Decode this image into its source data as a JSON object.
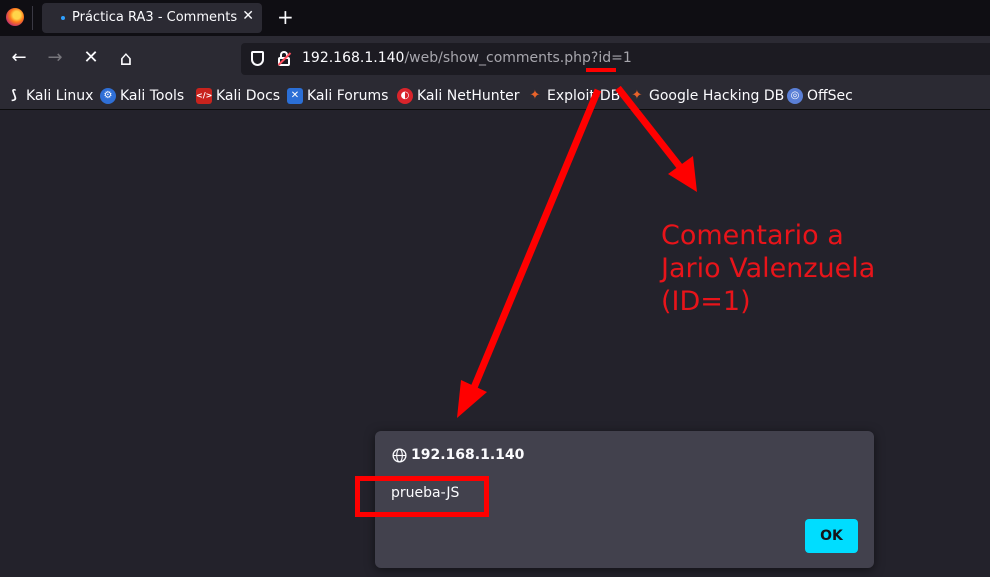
{
  "browser": {
    "tab_title": "Práctica RA3 - Comments",
    "tab_close_glyph": "✕",
    "new_tab_glyph": "+",
    "url_host": "192.168.1.140",
    "url_path": "/web/show_comments.php?id=1"
  },
  "nav": {
    "back_glyph": "←",
    "forward_glyph": "→",
    "stop_glyph": "✕",
    "home_glyph": "⌂"
  },
  "bookmarks": [
    {
      "label": "Kali Linux",
      "icon": "kali-dragon-icon",
      "color": "#111111"
    },
    {
      "label": "Kali Tools",
      "icon": "kali-tools-icon",
      "color": "#2f6fd6"
    },
    {
      "label": "Kali Docs",
      "icon": "kali-docs-icon",
      "color": "#c8231d"
    },
    {
      "label": "Kali Forums",
      "icon": "kali-forums-icon",
      "color": "#2b6fd6"
    },
    {
      "label": "Kali NetHunter",
      "icon": "nethunter-icon",
      "color": "#d9242b"
    },
    {
      "label": "Exploit-DB",
      "icon": "exploit-db-icon",
      "color": "#e8632a"
    },
    {
      "label": "Google Hacking DB",
      "icon": "ghdb-icon",
      "color": "#e8632a"
    },
    {
      "label": "OffSec",
      "icon": "offsec-icon",
      "color": "#5a7fd6"
    }
  ],
  "dialog": {
    "origin": "192.168.1.140",
    "message": "prueba-JS",
    "ok_label": "OK"
  },
  "annotation": {
    "line1": "Comentario a",
    "line2": "Jario Valenzuela",
    "line3": "(ID=1)",
    "color": "#ff0000"
  }
}
